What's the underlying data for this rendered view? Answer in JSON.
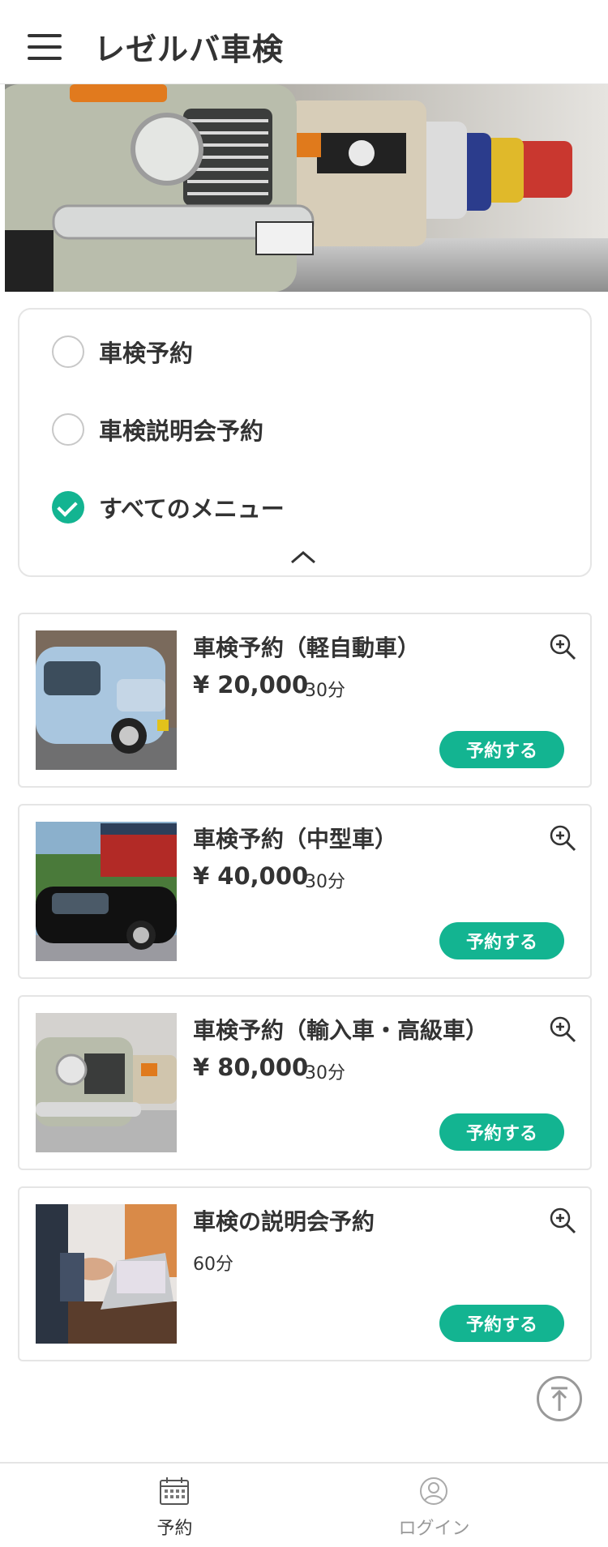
{
  "header": {
    "title": "レゼルバ車検",
    "menu_icon": "hamburger-menu-icon"
  },
  "hero": {
    "image": "vintage-cars-row-photo"
  },
  "filter": {
    "options": [
      {
        "label": "車検予約",
        "selected": false
      },
      {
        "label": "車検説明会予約",
        "selected": false
      },
      {
        "label": "すべてのメニュー",
        "selected": true
      }
    ],
    "collapse_icon": "chevron-up-icon"
  },
  "services": [
    {
      "title": "車検予約（軽自動車）",
      "price": "¥ 20,000",
      "duration": "30分",
      "button": "予約する",
      "image": "light-blue-kei-car-photo"
    },
    {
      "title": "車検予約（中型車）",
      "price": "¥ 40,000",
      "duration": "30分",
      "button": "予約する",
      "image": "black-sedan-farm-photo"
    },
    {
      "title": "車検予約（輸入車・高級車）",
      "price": "¥ 80,000",
      "duration": "30分",
      "button": "予約する",
      "image": "vintage-cars-row-photo"
    },
    {
      "title": "車検の説明会予約",
      "price": "",
      "duration": "60分",
      "button": "予約する",
      "image": "laptop-meeting-photo"
    }
  ],
  "scroll_top_icon": "arrow-up-icon",
  "bottom_nav": {
    "reserve_label": "予約",
    "login_label": "ログイン"
  },
  "colors": {
    "accent": "#13b491",
    "text": "#333333",
    "muted": "#999999",
    "border": "#e5e5e5"
  }
}
